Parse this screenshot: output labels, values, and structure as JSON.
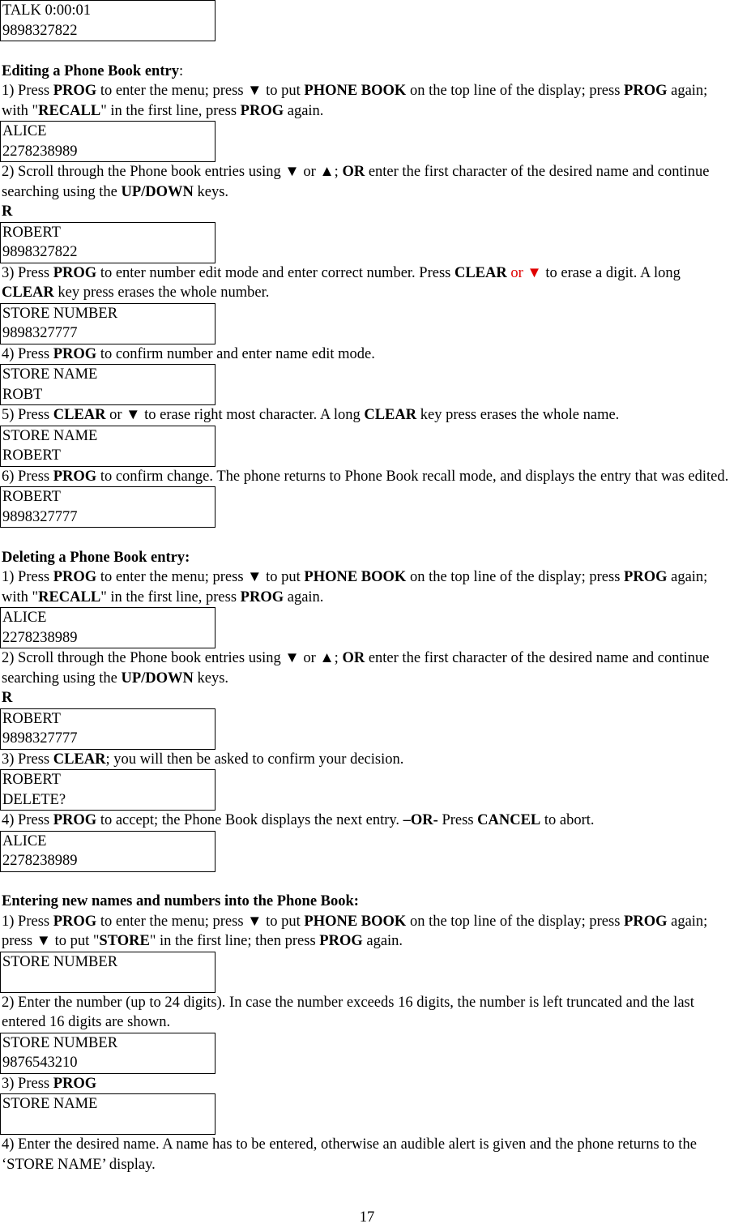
{
  "displays": {
    "talk": [
      "TALK 0:00:01",
      "9898327822"
    ],
    "alice": [
      "ALICE",
      "2278238989"
    ],
    "robert_old": [
      "ROBERT",
      "9898327822"
    ],
    "store_number_edit": [
      "STORE NUMBER",
      "9898327777"
    ],
    "store_name_robt": [
      "STORE NAME",
      "ROBT"
    ],
    "store_name_robert": [
      "STORE NAME",
      "ROBERT"
    ],
    "robert_new": [
      "ROBERT",
      "9898327777"
    ],
    "robert_delete": [
      "ROBERT",
      "DELETE?"
    ],
    "store_number_empty": [
      "STORE NUMBER",
      ""
    ],
    "store_number_new": [
      "STORE NUMBER",
      "9876543210"
    ],
    "store_name_empty": [
      "STORE NAME",
      ""
    ]
  },
  "sections": {
    "editing": {
      "title": "Editing a Phone Book entry",
      "title_suffix": ":",
      "step1": [
        "1) Press ",
        "PROG",
        " to enter the menu; press ▼ to put ",
        "PHONE BOOK",
        " on the top line of the display; press ",
        "PROG",
        " again; with \"",
        "RECALL",
        "\" in the first line, press ",
        "PROG",
        " again."
      ],
      "step2": [
        "2) Scroll through the Phone book entries using ▼ or ▲; ",
        "OR",
        " enter the first character of the desired name and continue searching using the ",
        "UP/DOWN",
        " keys."
      ],
      "char": "R",
      "step3": [
        "3) Press ",
        "PROG",
        " to enter number edit mode and enter correct number. Press ",
        "CLEAR",
        " or ▼",
        " to erase a digit. A long ",
        "CLEAR",
        " key press erases the whole number."
      ],
      "step4": [
        "4) Press ",
        "PROG",
        " to confirm number and enter name edit mode."
      ],
      "step5": [
        "5) Press ",
        "CLEAR",
        " or ▼ to erase right most character. A long ",
        "CLEAR",
        " key press erases the whole name."
      ],
      "step6": [
        "6) Press ",
        "PROG",
        " to confirm change. The phone returns to Phone Book recall mode, and displays the entry that was edited."
      ]
    },
    "deleting": {
      "title": "Deleting a Phone Book entry:",
      "step1": [
        "1) Press ",
        "PROG",
        " to enter the menu; press ▼ to put ",
        "PHONE BOOK",
        " on the top line of the display; press ",
        "PROG",
        " again; with \"",
        "RECALL",
        "\" in the first line,  press ",
        "PROG",
        " again."
      ],
      "step2": [
        "2) Scroll through the Phone book entries using ▼ or ▲; ",
        "OR",
        " enter the first character of the desired name and continue searching using the ",
        "UP/DOWN",
        " keys."
      ],
      "char": "R",
      "step3": [
        "3) Press ",
        "CLEAR",
        "; you will then be asked to confirm your decision."
      ],
      "step4": [
        "4) Press ",
        "PROG",
        " to accept; the Phone Book displays the next entry. ",
        "–OR-",
        " Press ",
        "CANCEL",
        " to abort."
      ]
    },
    "entering": {
      "title": "Entering new names and numbers into the Phone Book:",
      "step1": [
        "1) Press ",
        "PROG",
        " to enter the menu; press ▼ to put ",
        "PHONE BOOK",
        " on the top line of the display; press ",
        "PROG",
        " again; press ▼ to put \"",
        "STORE",
        "\" in the first line; then press ",
        "PROG",
        " again."
      ],
      "step2": "2) Enter the number (up to 24 digits). In case the number exceeds 16 digits, the number is left truncated and the last entered 16 digits are shown.",
      "step3": [
        "3) Press ",
        "PROG"
      ],
      "step4": "4) Enter the desired name. A name has to be entered, otherwise an audible alert is given and the phone returns to the ‘STORE NAME’ display."
    }
  },
  "page_number": "17",
  "colors": {
    "highlight": "#e00000"
  }
}
